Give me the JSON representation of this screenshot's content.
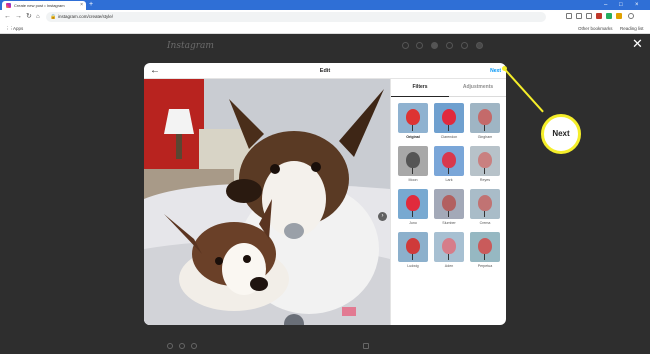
{
  "browser": {
    "tab_title": "Create new post • Instagram",
    "tab_close": "×",
    "new_tab": "+",
    "url": "instagram.com/create/style/",
    "bookmarks": {
      "apps": "Apps",
      "other": "Other bookmarks",
      "reading_list": "Reading list"
    },
    "window_controls": {
      "minimize": "–",
      "maximize": "□",
      "close": "×"
    }
  },
  "instagram": {
    "logo": "Instagram"
  },
  "modal": {
    "title": "Edit",
    "back": "←",
    "next": "Next",
    "close": "✕",
    "tabs": [
      "Filters",
      "Adjustments"
    ],
    "active_tab": "Filters",
    "filters": [
      "Original",
      "Clarendon",
      "Gingham",
      "Moon",
      "Lark",
      "Reyes",
      "Juno",
      "Slumber",
      "Crema",
      "Ludwig",
      "Aden",
      "Perpetua"
    ],
    "selected_filter": "Original"
  },
  "callout": {
    "label": "Next",
    "color": "#f5ee2a"
  }
}
